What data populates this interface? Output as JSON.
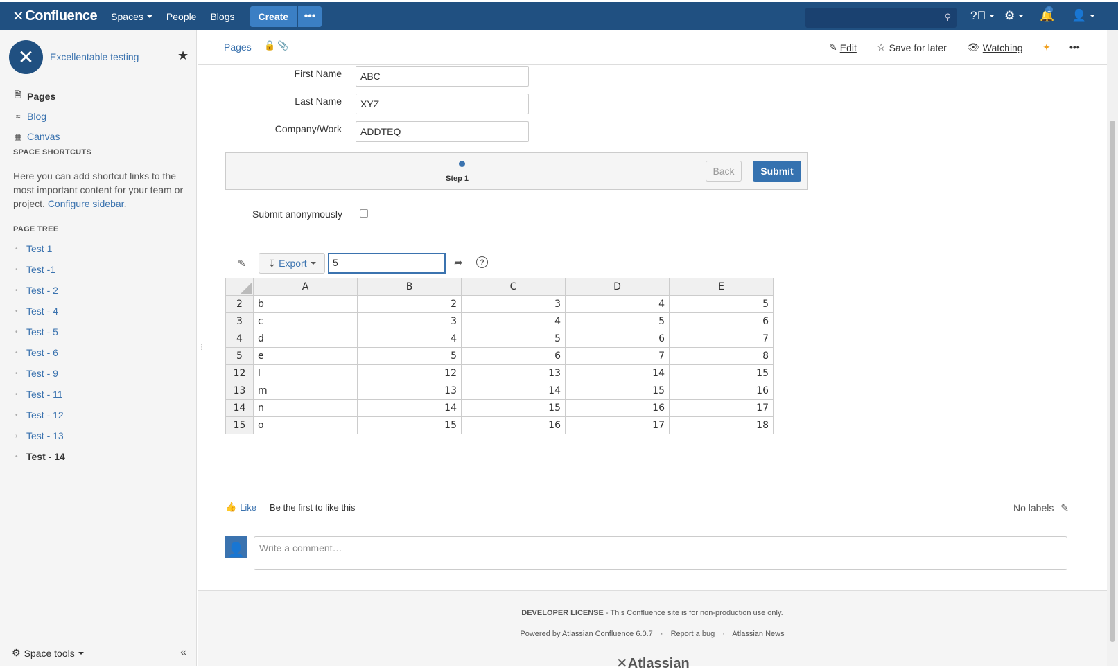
{
  "nav": {
    "logo": "Confluence",
    "spaces": "Spaces",
    "people": "People",
    "blogs": "Blogs",
    "create": "Create",
    "more": "•••",
    "notifications_count": "1"
  },
  "sidebar": {
    "space_name": "Excellentable testing",
    "items": [
      {
        "label": "Pages"
      },
      {
        "label": "Blog"
      },
      {
        "label": "Canvas"
      }
    ],
    "shortcuts_title": "SPACE SHORTCUTS",
    "shortcuts_text": "Here you can add shortcut links to the most important content for your team or project.",
    "configure_link": "Configure sidebar",
    "tree_title": "PAGE TREE",
    "tree": [
      "Test 1",
      "Test -1",
      "Test - 2",
      "Test - 4",
      "Test - 5",
      "Test - 6",
      "Test - 9",
      "Test - 11",
      "Test - 12",
      "Test - 13",
      "Test - 14"
    ],
    "space_tools": "Space tools"
  },
  "header": {
    "breadcrumb": "Pages",
    "edit": "Edit",
    "save_for_later": "Save for later",
    "watching": "Watching"
  },
  "form": {
    "first_name_label": "First Name",
    "first_name_value": "ABC",
    "last_name_label": "Last Name",
    "last_name_value": "XYZ",
    "company_label": "Company/Work",
    "company_value": "ADDTEQ",
    "step_label": "Step 1",
    "back": "Back",
    "submit": "Submit",
    "anonymous_label": "Submit anonymously"
  },
  "sheet": {
    "export": "Export",
    "input_value": "5",
    "columns": [
      "A",
      "B",
      "C",
      "D",
      "E"
    ],
    "rows": [
      {
        "n": "2",
        "a": "b",
        "b": "2",
        "c": "3",
        "d": "4",
        "e": "5"
      },
      {
        "n": "3",
        "a": "c",
        "b": "3",
        "c": "4",
        "d": "5",
        "e": "6"
      },
      {
        "n": "4",
        "a": "d",
        "b": "4",
        "c": "5",
        "d": "6",
        "e": "7"
      },
      {
        "n": "5",
        "a": "e",
        "b": "5",
        "c": "6",
        "d": "7",
        "e": "8"
      },
      {
        "n": "12",
        "a": "l",
        "b": "12",
        "c": "13",
        "d": "14",
        "e": "15"
      },
      {
        "n": "13",
        "a": "m",
        "b": "13",
        "c": "14",
        "d": "15",
        "e": "16"
      },
      {
        "n": "14",
        "a": "n",
        "b": "14",
        "c": "15",
        "d": "16",
        "e": "17"
      },
      {
        "n": "15",
        "a": "o",
        "b": "15",
        "c": "16",
        "d": "17",
        "e": "18"
      }
    ]
  },
  "social": {
    "like": "Like",
    "like_text": "Be the first to like this",
    "no_labels": "No labels",
    "comment_placeholder": "Write a comment…"
  },
  "footer": {
    "license_bold": "DEVELOPER LICENSE",
    "license_rest": " - This Confluence site is for non-production use only.",
    "powered": "Powered by Atlassian Confluence 6.0.7",
    "report_bug": "Report a bug",
    "news": "Atlassian News",
    "atlassian": "Atlassian"
  }
}
